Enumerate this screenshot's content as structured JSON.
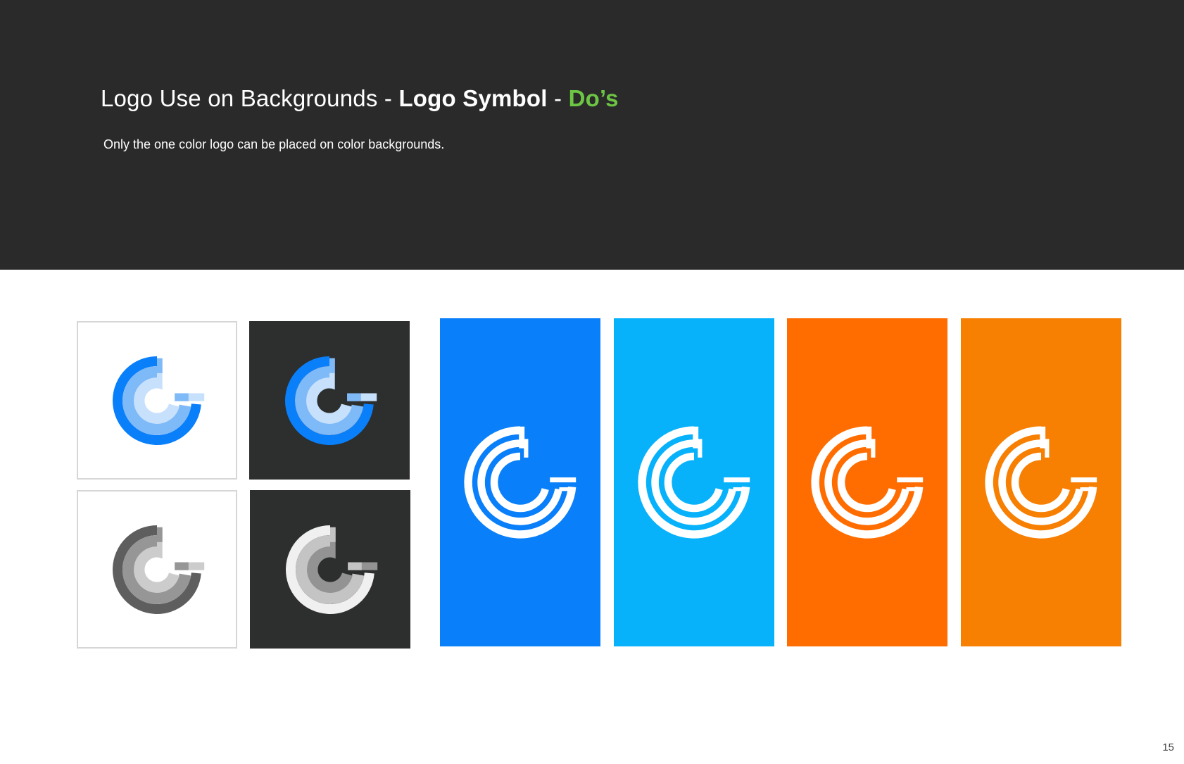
{
  "header": {
    "title_part1": "Logo Use on Backgrounds - ",
    "title_part2": "Logo Symbol",
    "title_sep": " - ",
    "title_part3": "Do’s",
    "subtitle": "Only the one color logo can be placed on color backgrounds."
  },
  "colors": {
    "header_bg": "#2a2a2a",
    "dos_green": "#6cc644",
    "tile_dark": "#2d2e2e",
    "blue": "#0a7ffa",
    "cyan": "#07b2fb",
    "orange": "#ff6d01",
    "orange_light": "#f77f02"
  },
  "tiles": [
    {
      "id": "fullcolor-on-white",
      "background": "#ffffff",
      "style": "layered",
      "tones": [
        "#0a7ffa",
        "#7eb9f8",
        "#c7e0fc"
      ],
      "center": "#ffffff"
    },
    {
      "id": "fullcolor-on-dark",
      "background": "#2d2e2e",
      "style": "layered",
      "tones": [
        "#0a7ffa",
        "#7eb9f8",
        "#c7e0fc"
      ],
      "center": "#2d2e2e"
    },
    {
      "id": "grayscale-on-white",
      "background": "#ffffff",
      "style": "layered",
      "tones": [
        "#5e5e5e",
        "#969696",
        "#cccccc"
      ],
      "center": "#ffffff"
    },
    {
      "id": "grayscale-on-dark",
      "background": "#2d2e2e",
      "style": "layered",
      "tones": [
        "#f0f0f0",
        "#c4c4c4",
        "#939393"
      ],
      "center": "#2d2e2e"
    },
    {
      "id": "onecolor-on-blue",
      "background": "#0a7ffa",
      "style": "outline",
      "color": "#ffffff"
    },
    {
      "id": "onecolor-on-cyan",
      "background": "#07b2fb",
      "style": "outline",
      "color": "#ffffff"
    },
    {
      "id": "onecolor-on-orange",
      "background": "#ff6d01",
      "style": "outline",
      "color": "#ffffff"
    },
    {
      "id": "onecolor-on-light-orange",
      "background": "#f77f02",
      "style": "outline",
      "color": "#ffffff"
    }
  ],
  "page_number": "15"
}
